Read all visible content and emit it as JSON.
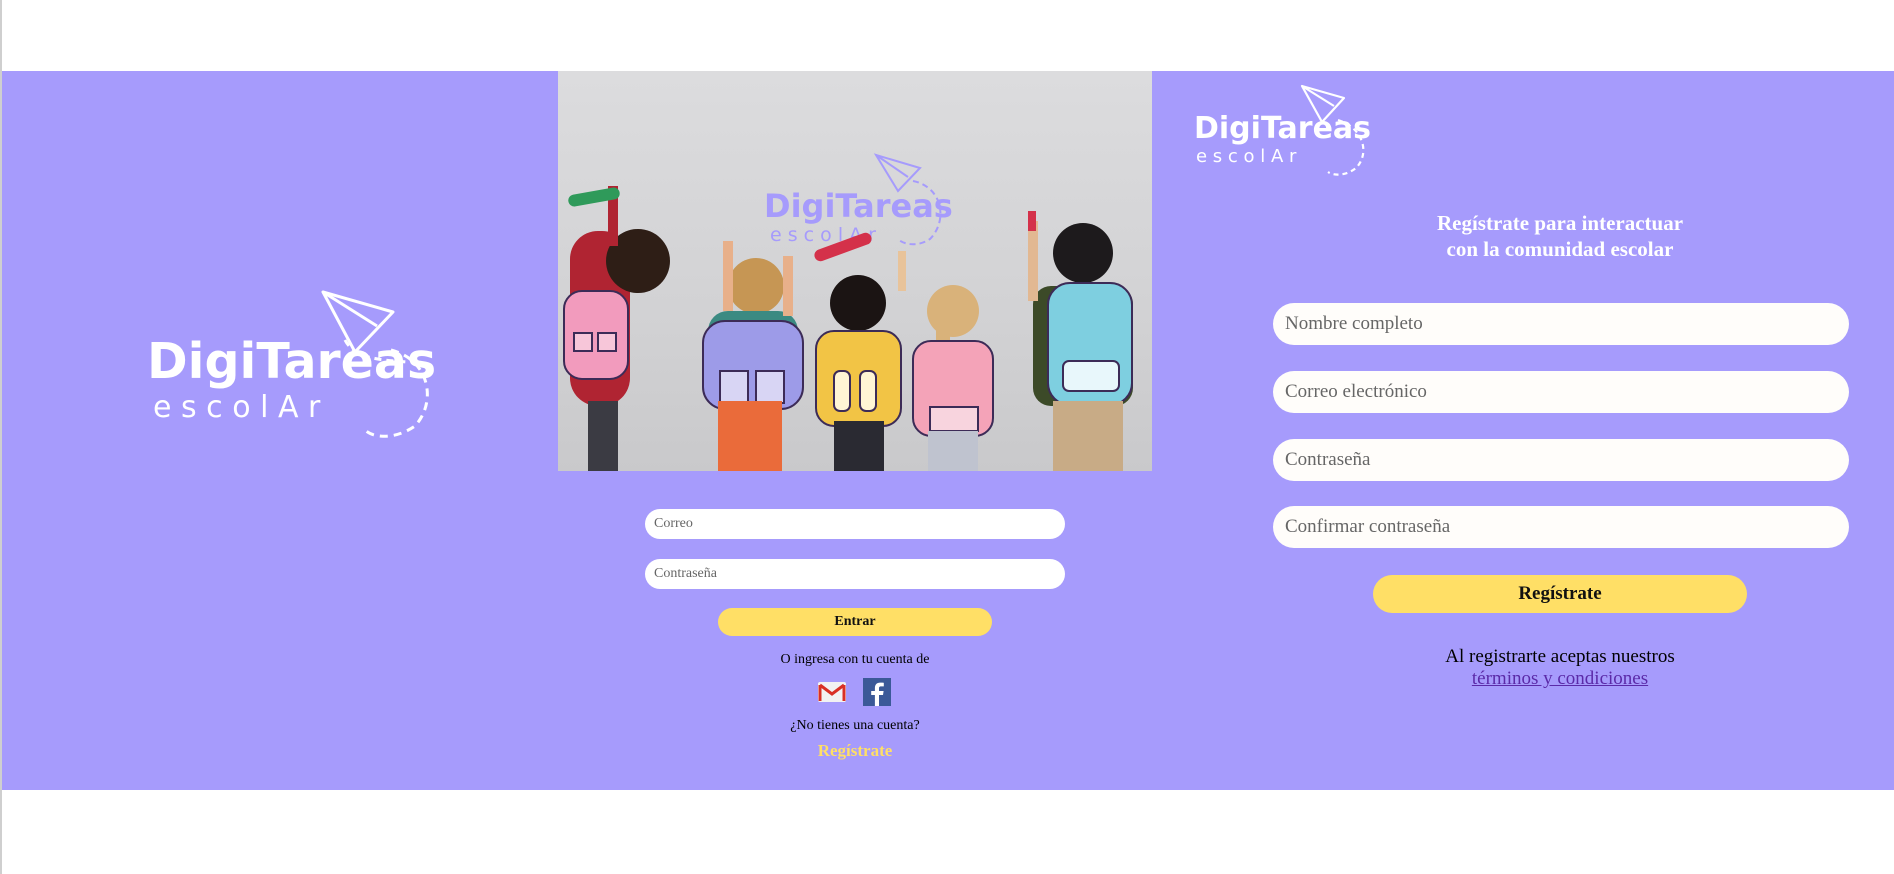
{
  "brand": {
    "name_top": "DigiTareas",
    "name_bottom": "e s c o l A r"
  },
  "colors": {
    "background_band": "#a69bfc",
    "accent_yellow": "#ffdf66",
    "white": "#ffffff",
    "link_purple": "#5b2aa8"
  },
  "login": {
    "email_placeholder": "Correo",
    "password_placeholder": "Contraseña",
    "submit_label": "Entrar",
    "alt_text": "O ingresa con tu cuenta de",
    "social_icons": [
      "gmail-icon",
      "facebook-icon"
    ],
    "no_account_text": "¿No tienes una cuenta?",
    "register_link": "Regístrate"
  },
  "register": {
    "title_line1": "Regístrate para interactuar",
    "title_line2": "con la comunidad escolar",
    "fullname_placeholder": "Nombre completo",
    "email_placeholder": "Correo electrónico",
    "password_placeholder": "Contraseña",
    "confirm_placeholder": "Confirmar contraseña",
    "submit_label": "Regístrate",
    "terms_text": "Al registrarte aceptas nuestros",
    "terms_link": "términos y condiciones"
  }
}
